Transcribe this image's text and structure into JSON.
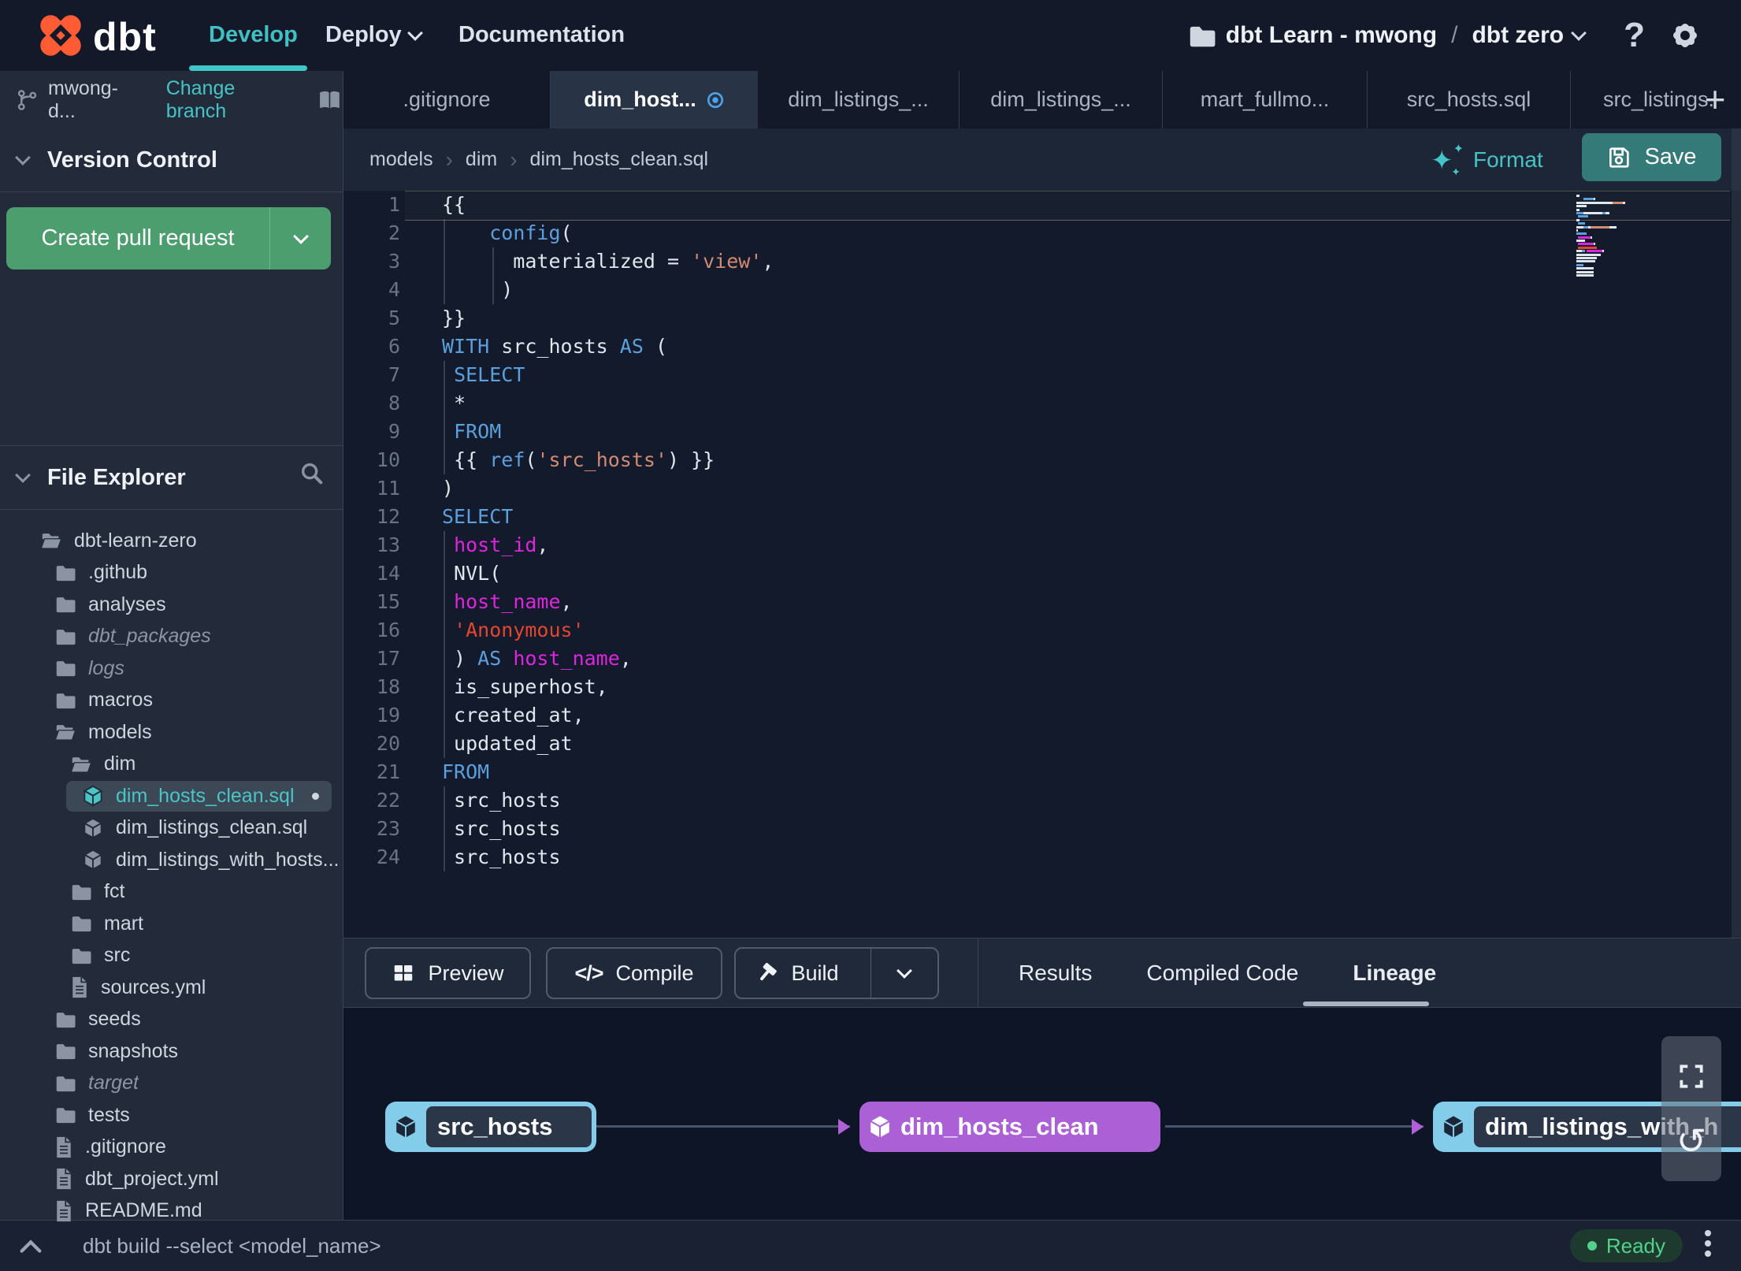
{
  "nav": {
    "brand": "dbt",
    "items": [
      {
        "label": "Develop",
        "active": true
      },
      {
        "label": "Deploy",
        "chevron": true
      },
      {
        "label": "Documentation"
      }
    ],
    "project": {
      "name": "dbt Learn - mwong",
      "separator": "/",
      "environment": "dbt zero"
    }
  },
  "branch_bar": {
    "branch": "mwong-d...",
    "action": "Change branch"
  },
  "tabs": {
    "add_label": "+",
    "items": [
      {
        "label": ".gitignore"
      },
      {
        "label": "dim_host...",
        "active": true,
        "dirty": true
      },
      {
        "label": "dim_listings_..."
      },
      {
        "label": "dim_listings_..."
      },
      {
        "label": "mart_fullmo..."
      },
      {
        "label": "src_hosts.sql"
      },
      {
        "label": "src_listings."
      }
    ]
  },
  "sidebar": {
    "version_control": {
      "title": "Version Control",
      "create_pr_label": "Create pull request"
    },
    "file_explorer": {
      "title": "File Explorer",
      "tree": [
        {
          "label": "dbt-learn-zero",
          "icon": "folder-open",
          "level": 0
        },
        {
          "label": ".github",
          "icon": "folder",
          "level": 1
        },
        {
          "label": "analyses",
          "icon": "folder",
          "level": 1
        },
        {
          "label": "dbt_packages",
          "icon": "folder",
          "level": 1,
          "muted": true
        },
        {
          "label": "logs",
          "icon": "folder",
          "level": 1,
          "muted": true
        },
        {
          "label": "macros",
          "icon": "folder",
          "level": 1
        },
        {
          "label": "models",
          "icon": "folder-open",
          "level": 1
        },
        {
          "label": "dim",
          "icon": "folder-open",
          "level": 2
        },
        {
          "label": "dim_hosts_clean.sql",
          "icon": "cube",
          "level": 3,
          "selected": true,
          "dirty": true
        },
        {
          "label": "dim_listings_clean.sql",
          "icon": "cube",
          "level": 3
        },
        {
          "label": "dim_listings_with_hosts...",
          "icon": "cube",
          "level": 3
        },
        {
          "label": "fct",
          "icon": "folder",
          "level": 2
        },
        {
          "label": "mart",
          "icon": "folder",
          "level": 2
        },
        {
          "label": "src",
          "icon": "folder",
          "level": 2
        },
        {
          "label": "sources.yml",
          "icon": "file",
          "level": 2
        },
        {
          "label": "seeds",
          "icon": "folder",
          "level": 1
        },
        {
          "label": "snapshots",
          "icon": "folder",
          "level": 1
        },
        {
          "label": "target",
          "icon": "folder",
          "level": 1,
          "muted": true
        },
        {
          "label": "tests",
          "icon": "folder",
          "level": 1
        },
        {
          "label": ".gitignore",
          "icon": "file",
          "level": 1
        },
        {
          "label": "dbt_project.yml",
          "icon": "file",
          "level": 1
        },
        {
          "label": "README.md",
          "icon": "file",
          "level": 1
        }
      ]
    }
  },
  "editor": {
    "breadcrumb": [
      "models",
      "dim",
      "dim_hosts_clean.sql"
    ],
    "format_label": "Format",
    "save_label": "Save",
    "code": {
      "lines": [
        [
          {
            "t": "{{",
            "c": "w"
          }
        ],
        [
          {
            "t": "    ",
            "c": "w"
          },
          {
            "t": "config",
            "c": "b"
          },
          {
            "t": "(",
            "c": "w"
          }
        ],
        [
          {
            "t": "      materialized = ",
            "c": "w"
          },
          {
            "t": "'view'",
            "c": "s"
          },
          {
            "t": ",",
            "c": "w"
          }
        ],
        [
          {
            "t": "     )",
            "c": "w"
          }
        ],
        [
          {
            "t": "}}",
            "c": "w"
          }
        ],
        [
          {
            "t": "WITH",
            "c": "b"
          },
          {
            "t": " src_hosts ",
            "c": "w"
          },
          {
            "t": "AS",
            "c": "b"
          },
          {
            "t": " (",
            "c": "w"
          }
        ],
        [
          {
            "t": " ",
            "c": "w"
          },
          {
            "t": "SELECT",
            "c": "b"
          }
        ],
        [
          {
            "t": " *",
            "c": "w"
          }
        ],
        [
          {
            "t": " ",
            "c": "w"
          },
          {
            "t": "FROM",
            "c": "b"
          }
        ],
        [
          {
            "t": " {{ ",
            "c": "w"
          },
          {
            "t": "ref",
            "c": "b"
          },
          {
            "t": "(",
            "c": "w"
          },
          {
            "t": "'src_hosts'",
            "c": "s"
          },
          {
            "t": ") }}",
            "c": "w"
          }
        ],
        [
          {
            "t": ")",
            "c": "w"
          }
        ],
        [
          {
            "t": "SELECT",
            "c": "b"
          }
        ],
        [
          {
            "t": " ",
            "c": "w"
          },
          {
            "t": "host_id",
            "c": "m"
          },
          {
            "t": ",",
            "c": "w"
          }
        ],
        [
          {
            "t": " NVL(",
            "c": "w"
          }
        ],
        [
          {
            "t": " ",
            "c": "w"
          },
          {
            "t": "host_name",
            "c": "m"
          },
          {
            "t": ",",
            "c": "w"
          }
        ],
        [
          {
            "t": " ",
            "c": "w"
          },
          {
            "t": "'Anonymous'",
            "c": "r"
          }
        ],
        [
          {
            "t": " ) ",
            "c": "w"
          },
          {
            "t": "AS",
            "c": "b"
          },
          {
            "t": " ",
            "c": "w"
          },
          {
            "t": "host_name",
            "c": "m"
          },
          {
            "t": ",",
            "c": "w"
          }
        ],
        [
          {
            "t": " is_superhost,",
            "c": "w"
          }
        ],
        [
          {
            "t": " created_at,",
            "c": "w"
          }
        ],
        [
          {
            "t": " updated_at",
            "c": "w"
          }
        ],
        [
          {
            "t": "FROM",
            "c": "b"
          }
        ],
        [
          {
            "t": " src_hosts",
            "c": "w"
          }
        ],
        [
          {
            "t": " src_hosts",
            "c": "w"
          }
        ],
        [
          {
            "t": " src_hosts",
            "c": "w"
          }
        ]
      ]
    }
  },
  "bottom_panel": {
    "actions": [
      {
        "label": "Preview"
      },
      {
        "label": "Compile"
      },
      {
        "label": "Build",
        "split": true
      }
    ],
    "tabs": [
      {
        "label": "Results"
      },
      {
        "label": "Compiled Code"
      },
      {
        "label": "Lineage",
        "active": true
      }
    ]
  },
  "lineage": {
    "nodes": [
      {
        "label": "src_hosts",
        "color": "blue"
      },
      {
        "label": "dim_hosts_clean",
        "color": "purple"
      },
      {
        "label": "dim_listings_with_h",
        "color": "blue"
      }
    ]
  },
  "status_bar": {
    "command": "dbt build --select <model_name>",
    "status": "Ready"
  },
  "colors": {
    "accent_teal": "#41c0c4",
    "brand_orange": "#ff5c35",
    "pr_button_green": "#4c9e6e",
    "save_button_teal": "#337a78",
    "status_ready_green": "#52d18c",
    "node_blue": "#84cdea",
    "node_purple": "#ab60d6",
    "unsaved_dot_blue": "#4ba3e8",
    "code_keyword_blue": "#5ba0dd",
    "code_string_salmon": "#d28b71",
    "code_string_red": "#e3462f",
    "code_identifier_magenta": "#de25de"
  }
}
